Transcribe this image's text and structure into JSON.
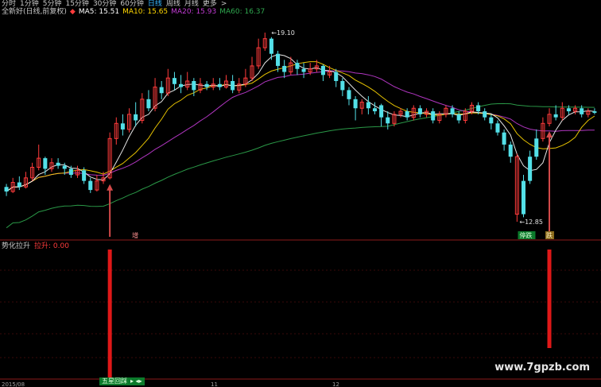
{
  "periods": [
    "分时",
    "1分钟",
    "5分钟",
    "15分钟",
    "30分钟",
    "60分钟",
    "日线",
    "周线",
    "月线",
    "更多",
    ">"
  ],
  "active_period": "日线",
  "info": {
    "name": "全新好(日线,前复权)",
    "ma5": "MA5: 15.51",
    "ma10": "MA10: 15.65",
    "ma20": "MA20: 15.93",
    "ma60": "MA60: 16.37"
  },
  "indicator": {
    "name": "势化拉升",
    "value": "拉升: 0.00"
  },
  "annotations": {
    "high": "19.10",
    "low": "12.85",
    "mark1": "增",
    "mark2": "停跌",
    "mark3": "跌"
  },
  "xaxis": {
    "t1": "2015/08",
    "t2": "11",
    "t3": "12"
  },
  "legend": {
    "label": "五星回踩",
    "arrows": "▸ ◂▸"
  },
  "watermark": "www.7gpzb.com",
  "colors": {
    "up": "#ff3b3b",
    "down": "#53e0e8",
    "ma5": "#ffffff",
    "ma10": "#ffd700",
    "ma20": "#c23bd4",
    "ma60": "#2fa84f",
    "signal": "#e01818"
  },
  "chart_data": {
    "type": "candlestick",
    "ylim": [
      12.3,
      19.6
    ],
    "candles": [
      [
        14.0,
        13.85,
        14.1,
        13.7,
        1
      ],
      [
        13.85,
        14.15,
        14.3,
        13.8,
        0
      ],
      [
        14.15,
        14.0,
        14.35,
        13.9,
        1
      ],
      [
        14.0,
        14.3,
        14.5,
        13.95,
        0
      ],
      [
        14.3,
        14.65,
        14.8,
        14.2,
        0
      ],
      [
        14.65,
        14.95,
        15.4,
        14.55,
        0
      ],
      [
        14.95,
        14.6,
        15.0,
        14.4,
        1
      ],
      [
        14.6,
        14.8,
        14.95,
        14.5,
        0
      ],
      [
        14.8,
        14.7,
        14.95,
        14.6,
        1
      ],
      [
        14.7,
        14.6,
        14.8,
        14.4,
        1
      ],
      [
        14.6,
        14.4,
        14.7,
        14.3,
        1
      ],
      [
        14.4,
        14.55,
        14.7,
        14.3,
        0
      ],
      [
        14.55,
        14.2,
        14.65,
        14.1,
        1
      ],
      [
        14.2,
        13.9,
        14.3,
        13.8,
        1
      ],
      [
        13.9,
        14.2,
        14.4,
        13.85,
        0
      ],
      [
        14.2,
        14.3,
        14.5,
        14.1,
        0
      ],
      [
        14.3,
        15.6,
        15.8,
        14.25,
        0
      ],
      [
        15.6,
        16.1,
        16.3,
        15.4,
        0
      ],
      [
        16.1,
        15.9,
        16.4,
        15.7,
        1
      ],
      [
        15.9,
        16.4,
        16.6,
        15.8,
        0
      ],
      [
        16.4,
        16.2,
        16.8,
        16.0,
        1
      ],
      [
        16.2,
        16.9,
        17.1,
        16.1,
        0
      ],
      [
        16.9,
        16.6,
        17.2,
        16.5,
        1
      ],
      [
        16.6,
        17.3,
        17.6,
        16.5,
        0
      ],
      [
        17.3,
        17.1,
        17.5,
        16.9,
        1
      ],
      [
        17.1,
        17.6,
        17.9,
        17.0,
        0
      ],
      [
        17.6,
        17.4,
        17.8,
        17.2,
        1
      ],
      [
        17.4,
        17.3,
        17.7,
        17.1,
        1
      ],
      [
        17.3,
        17.5,
        17.8,
        17.2,
        0
      ],
      [
        17.5,
        17.2,
        17.6,
        17.0,
        1
      ],
      [
        17.2,
        17.4,
        17.6,
        17.1,
        0
      ],
      [
        17.4,
        17.3,
        17.5,
        17.2,
        1
      ],
      [
        17.3,
        17.4,
        17.6,
        17.2,
        0
      ],
      [
        17.4,
        17.3,
        17.6,
        17.2,
        1
      ],
      [
        17.3,
        17.5,
        17.7,
        17.25,
        0
      ],
      [
        17.5,
        17.2,
        17.7,
        17.1,
        1
      ],
      [
        17.2,
        17.4,
        17.6,
        17.1,
        0
      ],
      [
        17.4,
        17.6,
        17.9,
        17.3,
        0
      ],
      [
        17.6,
        18.0,
        18.3,
        17.5,
        0
      ],
      [
        18.0,
        18.6,
        18.9,
        17.9,
        0
      ],
      [
        18.6,
        18.9,
        19.1,
        18.5,
        0
      ],
      [
        18.9,
        18.4,
        18.95,
        18.2,
        1
      ],
      [
        18.4,
        18.0,
        18.5,
        17.8,
        1
      ],
      [
        18.0,
        17.8,
        18.2,
        17.6,
        1
      ],
      [
        17.8,
        18.1,
        18.3,
        17.7,
        0
      ],
      [
        18.1,
        17.9,
        18.2,
        17.7,
        1
      ],
      [
        17.9,
        17.8,
        18.1,
        17.6,
        1
      ],
      [
        17.8,
        17.9,
        18.1,
        17.7,
        0
      ],
      [
        17.9,
        18.0,
        18.2,
        17.8,
        0
      ],
      [
        18.0,
        17.7,
        18.05,
        17.5,
        1
      ],
      [
        17.7,
        17.8,
        18.0,
        17.6,
        0
      ],
      [
        17.8,
        17.5,
        17.9,
        17.3,
        1
      ],
      [
        17.5,
        17.2,
        17.6,
        17.0,
        1
      ],
      [
        17.2,
        16.9,
        17.3,
        16.7,
        1
      ],
      [
        16.9,
        16.6,
        17.0,
        16.2,
        1
      ],
      [
        16.6,
        16.8,
        16.9,
        16.4,
        0
      ],
      [
        16.8,
        16.6,
        17.0,
        16.4,
        1
      ],
      [
        16.6,
        16.5,
        16.8,
        16.4,
        1
      ],
      [
        16.7,
        16.3,
        16.75,
        16.0,
        1
      ],
      [
        16.3,
        16.1,
        16.5,
        15.9,
        1
      ],
      [
        16.1,
        16.4,
        16.5,
        16.0,
        0
      ],
      [
        16.4,
        16.5,
        16.6,
        16.3,
        0
      ],
      [
        16.5,
        16.3,
        16.6,
        16.2,
        1
      ],
      [
        16.3,
        16.6,
        16.7,
        16.2,
        0
      ],
      [
        16.6,
        16.4,
        16.7,
        16.3,
        1
      ],
      [
        16.4,
        16.5,
        16.6,
        16.3,
        0
      ],
      [
        16.5,
        16.2,
        16.6,
        16.1,
        1
      ],
      [
        16.2,
        16.4,
        16.5,
        16.1,
        0
      ],
      [
        16.4,
        16.6,
        16.7,
        16.3,
        0
      ],
      [
        16.6,
        16.4,
        16.7,
        16.3,
        1
      ],
      [
        16.4,
        16.2,
        16.5,
        16.1,
        1
      ],
      [
        16.2,
        16.5,
        16.6,
        16.1,
        0
      ],
      [
        16.5,
        16.7,
        16.8,
        16.4,
        0
      ],
      [
        16.7,
        16.5,
        16.8,
        16.4,
        1
      ],
      [
        16.5,
        16.3,
        16.6,
        16.2,
        1
      ],
      [
        16.3,
        16.1,
        16.4,
        15.9,
        1
      ],
      [
        16.1,
        15.8,
        16.2,
        15.7,
        1
      ],
      [
        15.8,
        15.4,
        15.9,
        15.2,
        1
      ],
      [
        15.4,
        15.0,
        15.5,
        14.8,
        1
      ],
      [
        15.0,
        13.1,
        15.1,
        12.85,
        0
      ],
      [
        13.1,
        14.2,
        14.4,
        13.0,
        1
      ],
      [
        14.2,
        15.0,
        15.2,
        14.1,
        1
      ],
      [
        15.0,
        15.6,
        15.9,
        14.9,
        1
      ],
      [
        15.6,
        16.1,
        16.3,
        15.5,
        0
      ],
      [
        16.1,
        16.4,
        16.6,
        16.0,
        0
      ],
      [
        16.4,
        16.3,
        16.7,
        16.2,
        1
      ],
      [
        16.3,
        16.6,
        16.8,
        16.2,
        0
      ],
      [
        16.6,
        16.5,
        16.7,
        16.4,
        1
      ],
      [
        16.5,
        16.6,
        16.7,
        16.4,
        0
      ],
      [
        16.6,
        16.4,
        16.7,
        16.3,
        1
      ],
      [
        16.4,
        16.5,
        16.6,
        16.3,
        0
      ],
      [
        16.5,
        16.45,
        16.6,
        16.4,
        1
      ]
    ],
    "indicator_signal": [
      16,
      84
    ]
  }
}
